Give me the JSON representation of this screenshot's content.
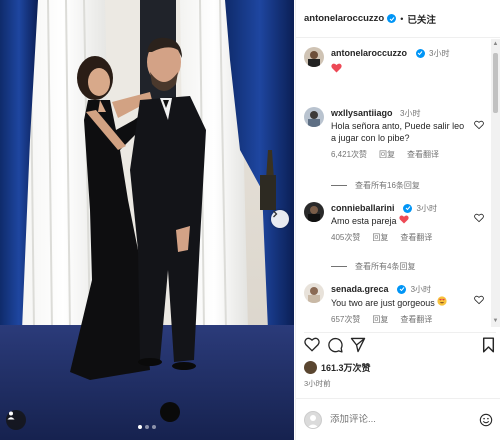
{
  "header": {
    "username": "antonelaroccuzzo",
    "separator": "•",
    "follow_label": "已关注"
  },
  "caption": {
    "username": "antonelaroccuzzo",
    "time": "3小时",
    "text_emoji": "heart"
  },
  "comments": [
    {
      "username": "wxllysantiiago",
      "time": "3小时",
      "text": "Hola señora anto, Puede salir leo a jugar con lo pibe?",
      "likes": "6,421次赞",
      "reply": "回复",
      "translate": "查看翻译",
      "view_replies": "查看所有16条回复"
    },
    {
      "username": "connieballarini",
      "time": "3小时",
      "text": "Amo esta pareja",
      "likes": "405次赞",
      "reply": "回复",
      "translate": "查看翻译",
      "view_replies": "查看所有4条回复"
    },
    {
      "username": "senada.greca",
      "time": "3小时",
      "text": "You two are just gorgeous",
      "likes": "657次赞",
      "reply": "回复",
      "translate": "查看翻译"
    }
  ],
  "footer": {
    "likes": "161.3万次赞",
    "posted": "3小时前",
    "comment_placeholder": "添加评论..."
  },
  "media": {
    "carousel_index": 1,
    "carousel_total": 3
  },
  "colors": {
    "verified": "#0095f6",
    "heart_red": "#ed4956",
    "muted": "#737373"
  }
}
